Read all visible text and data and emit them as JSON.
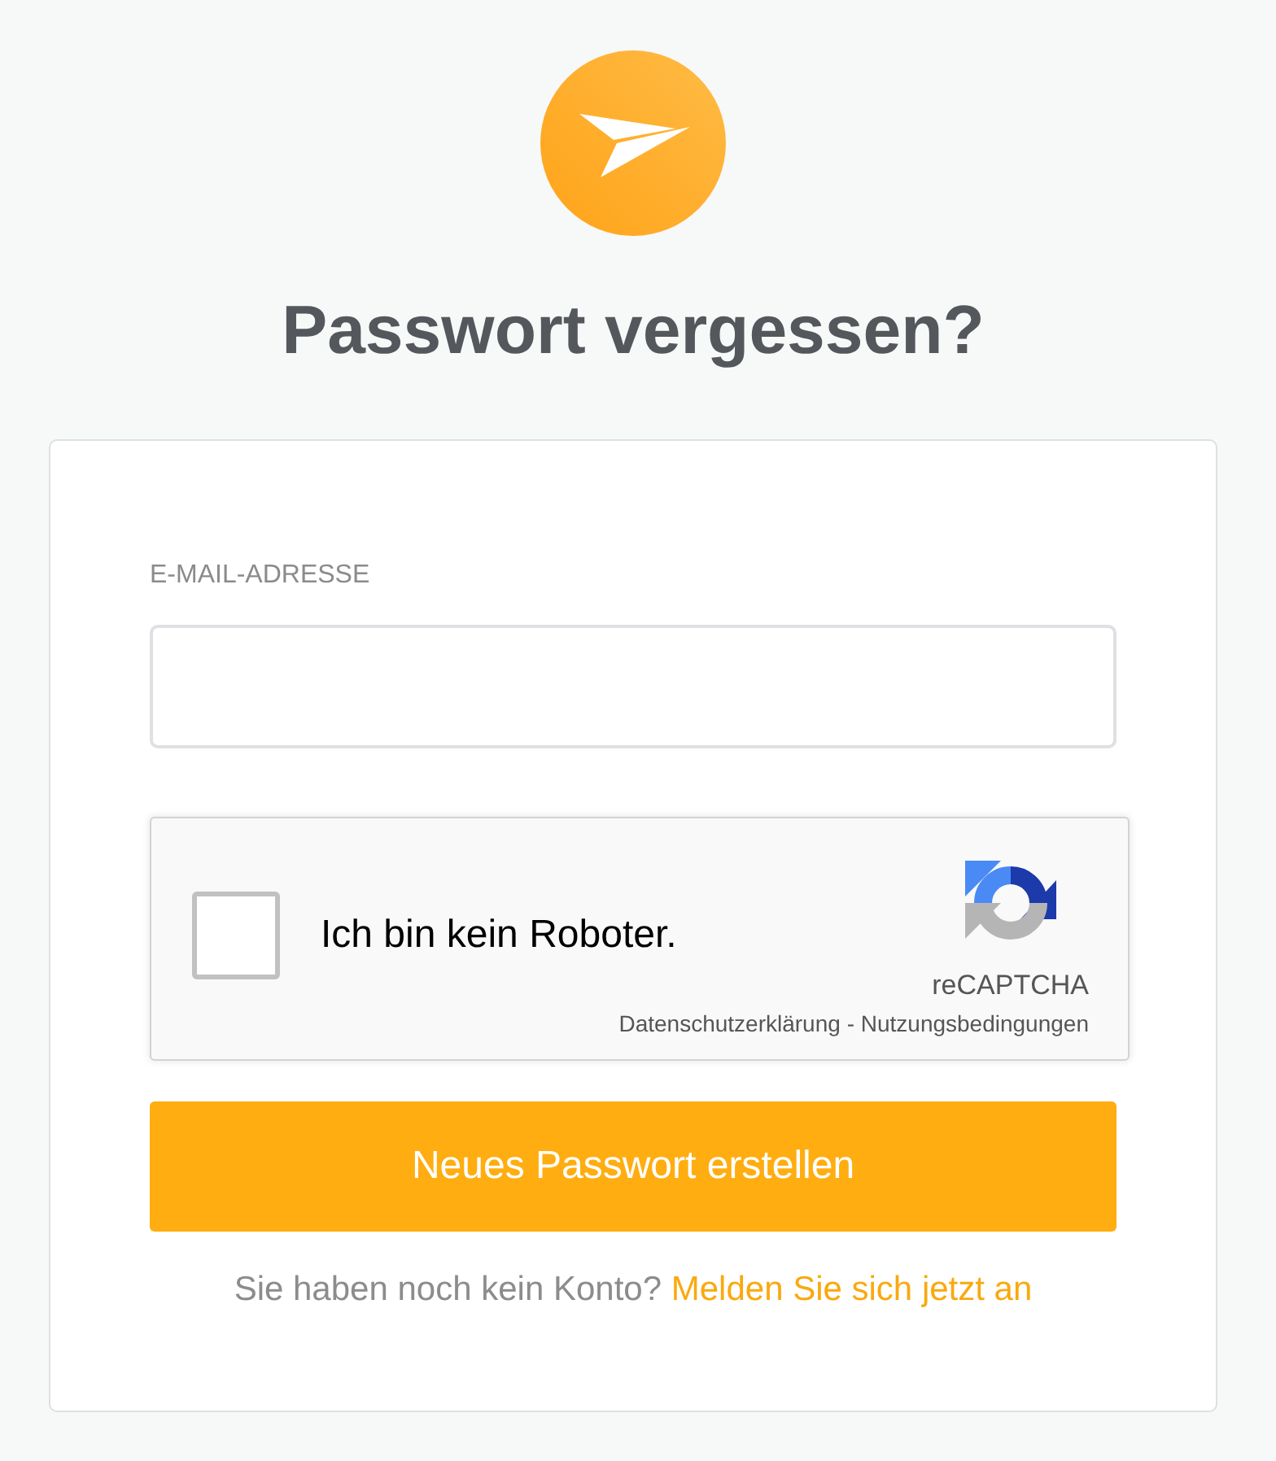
{
  "title": "Passwort vergessen?",
  "email_field": {
    "label": "E-MAIL-ADRESSE"
  },
  "captcha": {
    "checked": false,
    "label": "Ich bin kein Roboter.",
    "brand": "reCAPTCHA",
    "privacy_link": "Datenschutzerklärung",
    "separator": "-",
    "terms_link": "Nutzungsbedingungen"
  },
  "submit_button": {
    "label": "Neues Passwort erstellen"
  },
  "signup_prompt": {
    "text": "Sie haben noch kein Konto?",
    "link": "Melden Sie sich jetzt an"
  }
}
